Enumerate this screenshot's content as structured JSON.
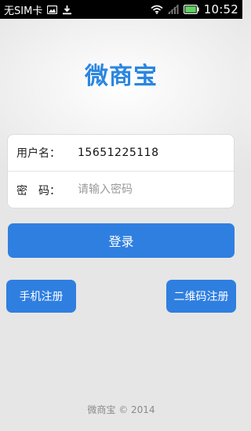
{
  "status_bar": {
    "carrier": "无SIM卡",
    "time": "10:52",
    "icons": [
      "image-icon",
      "download-icon",
      "wifi-icon",
      "signal-icon",
      "battery-icon"
    ]
  },
  "app": {
    "logo_text": "微商宝",
    "brand_color": "#2a86e0",
    "button_color": "#2f7fe0"
  },
  "login_form": {
    "username_label": "用户名：",
    "username_value": "15651225118",
    "password_label": "密　码：",
    "password_placeholder": "请输入密码"
  },
  "buttons": {
    "login": "登录",
    "phone_register": "手机注册",
    "qr_register": "二维码注册"
  },
  "footer": {
    "text": "微商宝 © 2014"
  }
}
